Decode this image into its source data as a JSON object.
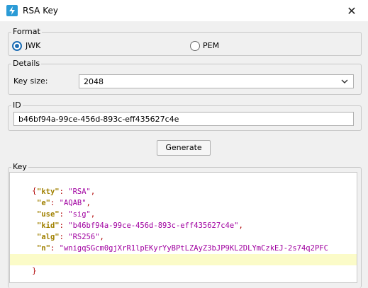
{
  "window": {
    "title": "RSA Key",
    "close_glyph": "✕"
  },
  "format": {
    "label": "Format",
    "options": [
      "JWK",
      "PEM"
    ],
    "selected": "JWK"
  },
  "details": {
    "label": "Details",
    "key_size_label": "Key size:",
    "key_size_value": "2048"
  },
  "id": {
    "label": "ID",
    "value": "b46bf94a-99ce-456d-893c-eff435627c4e"
  },
  "generate_label": "Generate",
  "key": {
    "label": "Key",
    "open_brace": "{",
    "close_brace": "}",
    "entries": [
      {
        "k": "\"kty\"",
        "v": "\"RSA\"",
        "comma": ","
      },
      {
        "k": "\"e\"",
        "v": "\"AQAB\"",
        "comma": ","
      },
      {
        "k": "\"use\"",
        "v": "\"sig\"",
        "comma": ","
      },
      {
        "k": "\"kid\"",
        "v": "\"b46bf94a-99ce-456d-893c-eff435627c4e\"",
        "comma": ","
      },
      {
        "k": "\"alg\"",
        "v": "\"RS256\"",
        "comma": ","
      },
      {
        "k": "\"n\"",
        "v": "\"wnigqSGcm0gjXrR1lpEKyrYyBPtLZAyZ3bJP9KL2DLYmCzkEJ-2s74q2PFC",
        "comma": ""
      }
    ]
  },
  "colors": {
    "accent": "#1f6fb5",
    "json_punctuation": "#b00000",
    "json_key": "#a08000",
    "json_string": "#a000a0",
    "highlight_line": "#fbfbc8"
  }
}
